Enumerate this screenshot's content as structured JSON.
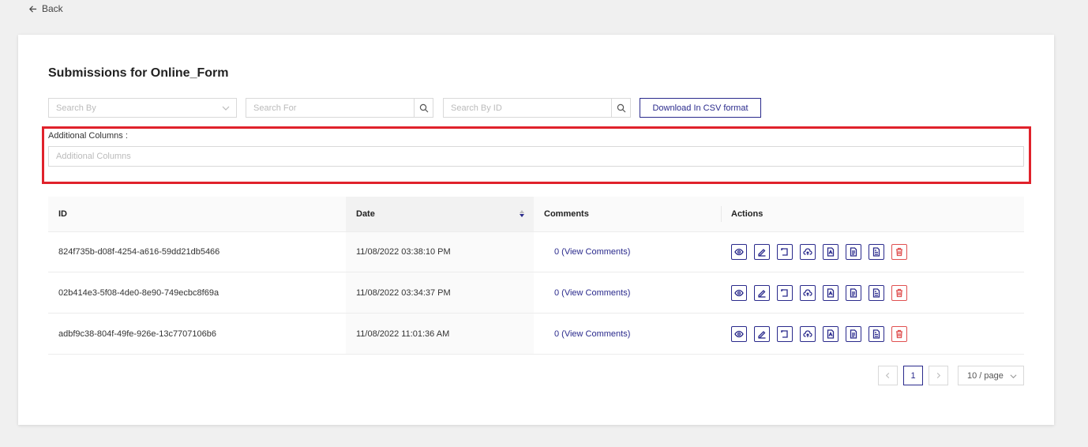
{
  "nav": {
    "back_label": "Back"
  },
  "page": {
    "title": "Submissions for Online_Form"
  },
  "filters": {
    "search_by_placeholder": "Search By",
    "search_for_placeholder": "Search For",
    "search_id_placeholder": "Search By ID",
    "csv_label": "Download In CSV format"
  },
  "additional": {
    "label": "Additional Columns :",
    "placeholder": "Additional Columns"
  },
  "table": {
    "headers": {
      "id": "ID",
      "date": "Date",
      "comments": "Comments",
      "actions": "Actions"
    },
    "rows": [
      {
        "id": "824f735b-d08f-4254-a616-59dd21db5466",
        "date": "11/08/2022 03:38:10 PM",
        "comments": "0 (View Comments)"
      },
      {
        "id": "02b414e3-5f08-4de0-8e90-749ecbc8f69a",
        "date": "11/08/2022 03:34:37 PM",
        "comments": "0 (View Comments)"
      },
      {
        "id": "adbf9c38-804f-49fe-926e-13c7707106b6",
        "date": "11/08/2022 11:01:36 AM",
        "comments": "0 (View Comments)"
      }
    ],
    "action_icons": [
      "eye-icon",
      "edit-icon",
      "return-icon",
      "cloud-upload-icon",
      "pdf-icon",
      "doc-icon",
      "file-icon",
      "delete-icon"
    ]
  },
  "pagination": {
    "current": "1",
    "page_size": "10 / page"
  },
  "colors": {
    "accent": "#2a2a8c",
    "danger": "#e05050",
    "highlight": "#e0222b"
  }
}
